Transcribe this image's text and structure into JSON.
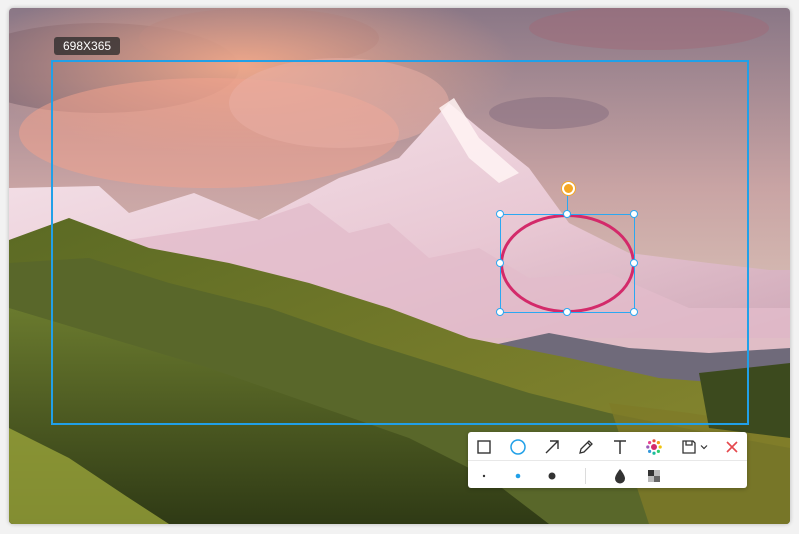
{
  "selection": {
    "size_label": "698X365"
  },
  "colors": {
    "accent": "#21a0e8",
    "ellipse": "#d32a6a",
    "rotate_handle": "#f5a623",
    "close": "#e5484d"
  },
  "toolbar": {
    "tools": [
      {
        "name": "rectangle",
        "icon": "rectangle-icon"
      },
      {
        "name": "ellipse",
        "icon": "ellipse-icon",
        "active": true
      },
      {
        "name": "arrow",
        "icon": "arrow-icon"
      },
      {
        "name": "pencil",
        "icon": "pencil-icon"
      },
      {
        "name": "text",
        "icon": "text-icon"
      },
      {
        "name": "color",
        "icon": "color-picker-icon"
      },
      {
        "name": "save",
        "icon": "save-icon"
      },
      {
        "name": "close",
        "icon": "close-icon"
      }
    ],
    "brush_sizes": [
      "small",
      "medium",
      "large"
    ],
    "selected_brush": "medium",
    "extra_tools": [
      "blur-icon",
      "mosaic-icon"
    ]
  }
}
